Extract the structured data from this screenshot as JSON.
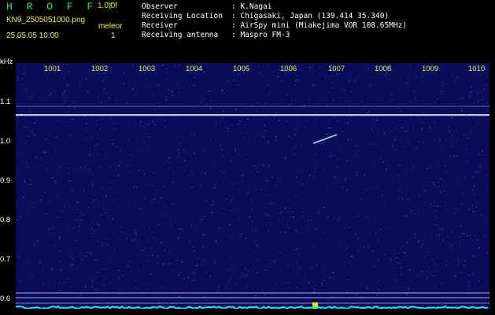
{
  "header": {
    "app_title": "H R O F F T",
    "version": "1.0.0f",
    "filename": "KN9_2505051000.png",
    "datetime": "25.05.05 10:00",
    "meleor_label": "meleor",
    "meleor_count": "1",
    "info": [
      {
        "key": "Observer",
        "value": ": K.Nagai"
      },
      {
        "key": "Receiving Location",
        "value": ": Chigasaki, Japan (139.414 35.340)"
      },
      {
        "key": "Receiver",
        "value": ": AirSpy mini (Miakejima VOR 108.65MHz)"
      },
      {
        "key": "Receiving antenna",
        "value": ": Maspro FM-3"
      }
    ]
  },
  "plot": {
    "unit": "kHz",
    "x_ticks": [
      "1001",
      "1002",
      "1003",
      "1004",
      "1005",
      "1006",
      "1007",
      "1008",
      "1009",
      "1010"
    ],
    "y_ticks": [
      "1.1",
      "1.0",
      "0.9",
      "0.8",
      "0.7",
      "0.6"
    ],
    "colors": {
      "background": "#0b0d5a",
      "noise": "#2a4ad8",
      "carrier": "#9ee9e0",
      "spectrum": "#1ee6f0",
      "meteor": "#f2e200"
    }
  }
}
